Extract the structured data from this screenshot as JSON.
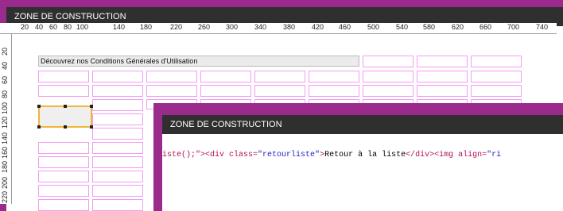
{
  "window": {
    "title": "ZONE DE CONSTRUCTION"
  },
  "ruler": {
    "h_labels": [
      "20",
      "40",
      "60",
      "80",
      "100",
      "140",
      "180",
      "220",
      "260",
      "300",
      "340",
      "380",
      "420",
      "460",
      "500",
      "540",
      "580",
      "620",
      "660",
      "700",
      "740"
    ],
    "v_labels": [
      "20",
      "40",
      "60",
      "80",
      "100",
      "120",
      "140",
      "160",
      "180",
      "200",
      "220"
    ]
  },
  "banner": {
    "text": "Découvrez nos Conditions Générales d'Utilisation"
  },
  "code_window": {
    "title": "ZONE DE CONSTRUCTION",
    "code_segments": [
      {
        "text": "iste();\">",
        "color": "c-red"
      },
      {
        "text": "<div class=",
        "color": "c-red"
      },
      {
        "text": "\"retourliste\"",
        "color": "c-blue"
      },
      {
        "text": ">",
        "color": "c-red"
      },
      {
        "text": "Retour à la liste",
        "color": "c-black"
      },
      {
        "text": "</div>",
        "color": "c-red"
      },
      {
        "text": "<img align=",
        "color": "c-red"
      },
      {
        "text": "\"ri",
        "color": "c-blue"
      }
    ]
  },
  "colors": {
    "frame": "#9b2a8d",
    "titlebar": "#2f2f2f",
    "cell_border": "#f29cf2",
    "selection": "#f0b53c"
  }
}
